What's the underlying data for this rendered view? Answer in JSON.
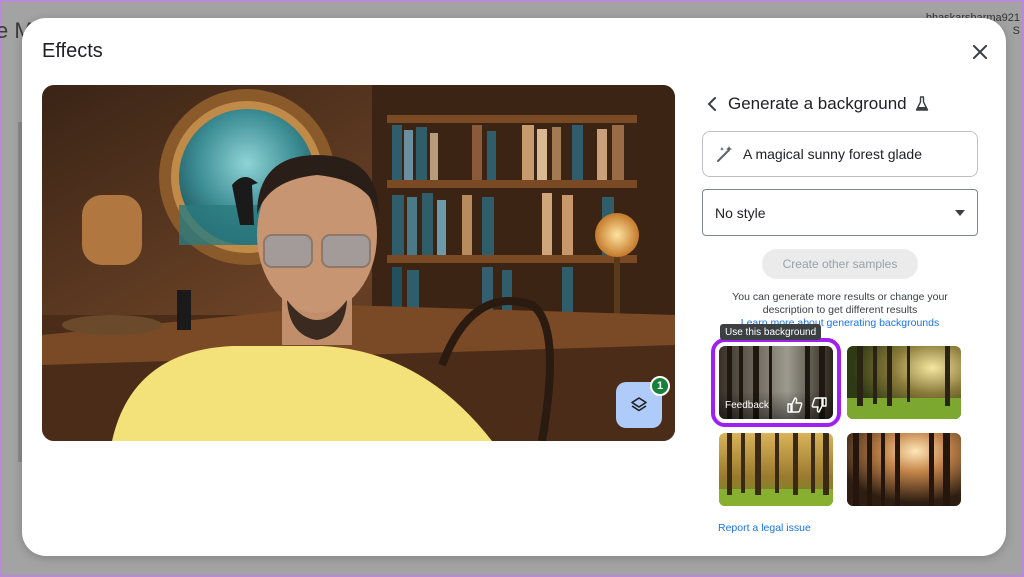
{
  "background_app": {
    "title_fragment": "e M",
    "email_fragment": "bhaskarsharma921",
    "email_line2": "S"
  },
  "dialog": {
    "title": "Effects",
    "close_icon": "close-icon"
  },
  "preview": {
    "effects_badge_count": "1",
    "effects_icon": "layers-icon"
  },
  "panel": {
    "title": "Generate a background",
    "back_icon": "chevron-left-icon",
    "lab_icon": "flask-icon",
    "prompt": {
      "icon": "magic-wand-icon",
      "value": "A magical sunny forest glade"
    },
    "style_select": {
      "value": "No style",
      "icon": "dropdown-arrow-icon"
    },
    "create_button": "Create other samples",
    "hint_line1": "You can generate more results or change your",
    "hint_line2": "description to get different results",
    "hint_link": "Learn more about generating backgrounds",
    "tooltip": "Use this background",
    "feedback_label": "Feedback",
    "report_link": "Report a legal issue"
  },
  "colors": {
    "accent_blue": "#1a73e8",
    "highlight_purple": "#a020f0",
    "badge_green": "#188038"
  }
}
